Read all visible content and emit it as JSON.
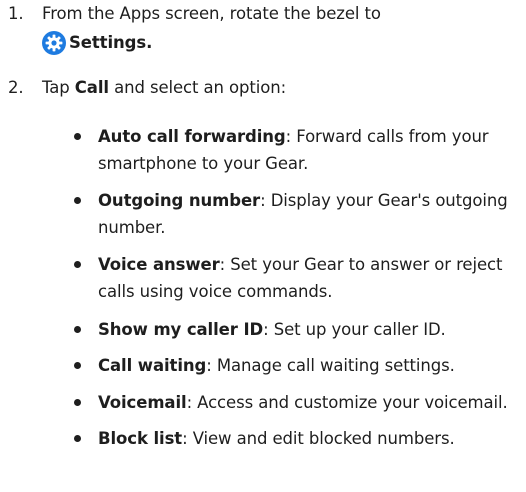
{
  "steps": [
    {
      "number": "1.",
      "line1": "From the Apps screen, rotate the bezel to",
      "settings_label": "Settings."
    },
    {
      "number": "2.",
      "prefix": "Tap ",
      "call_label": "Call",
      "suffix": " and select an option:"
    }
  ],
  "options": [
    {
      "term": "Auto call forwarding",
      "desc": ": Forward calls from your smartphone to your Gear."
    },
    {
      "term": "Outgoing number",
      "desc": ": Display your Gear's outgoing number."
    },
    {
      "term": "Voice answer",
      "desc": ": Set your Gear to answer or reject calls using voice commands."
    },
    {
      "term": "Show my caller ID",
      "desc": ": Set up your caller ID."
    },
    {
      "term": "Call waiting",
      "desc": ": Manage call waiting settings."
    },
    {
      "term": "Voicemail",
      "desc": ": Access and customize your voicemail."
    },
    {
      "term": "Block list",
      "desc": ": View and edit blocked numbers."
    }
  ],
  "colors": {
    "settings_icon": "#1e7be0",
    "text": "#1e1e1e"
  },
  "icons": {
    "settings": "gear-icon"
  }
}
